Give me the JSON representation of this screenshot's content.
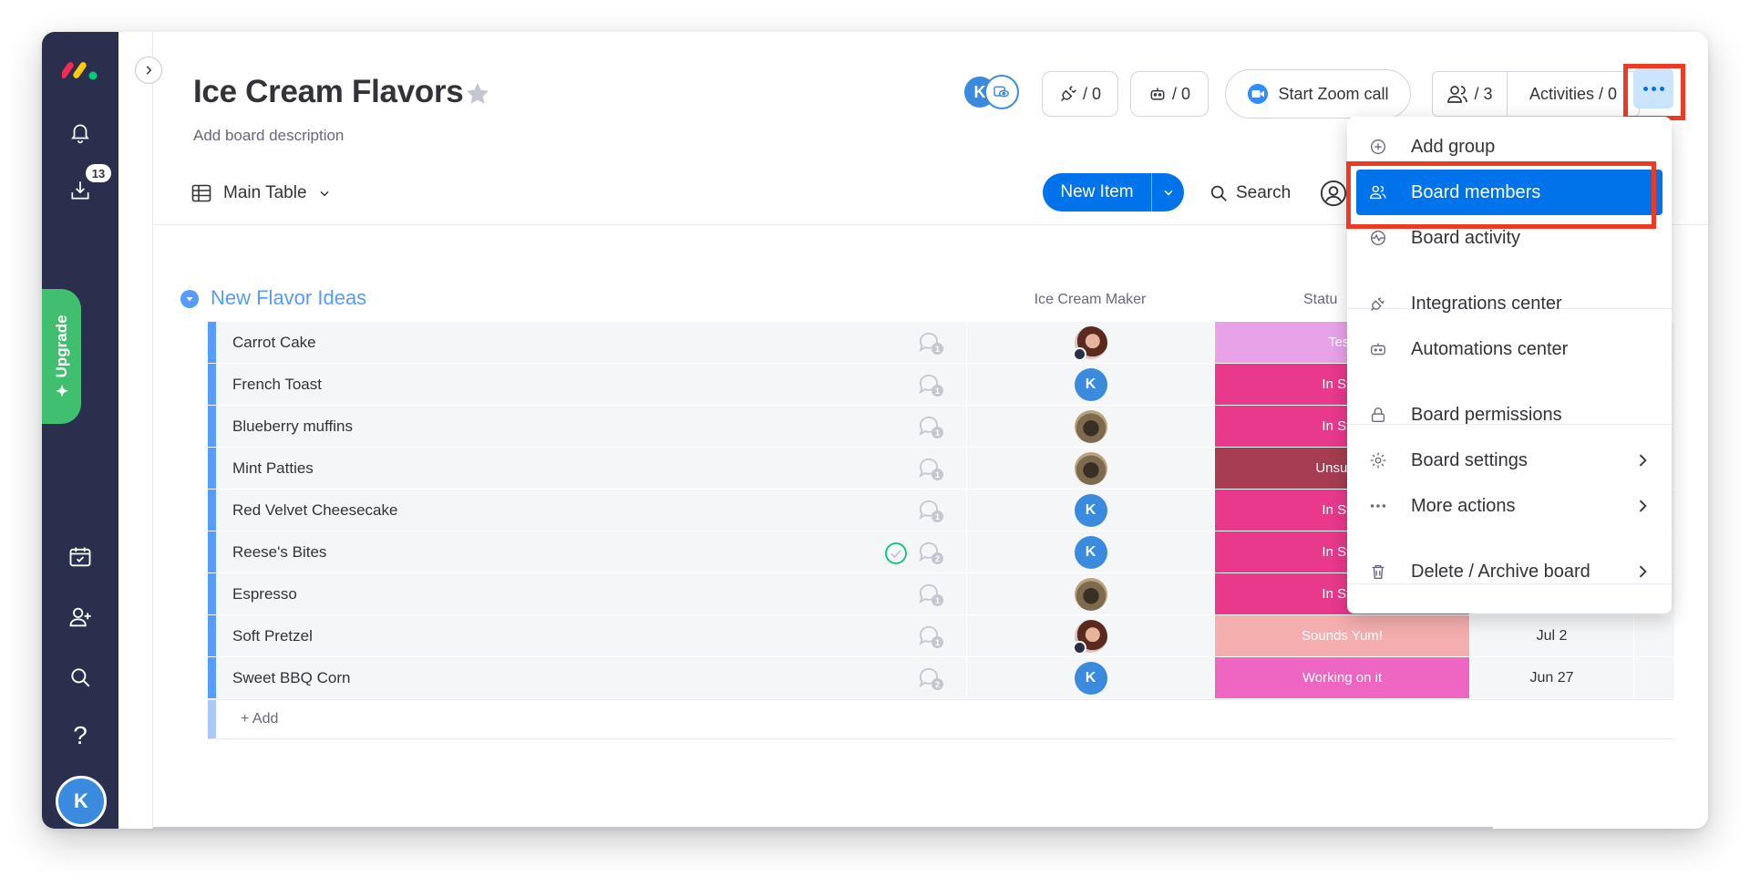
{
  "board": {
    "title": "Ice Cream Flavors",
    "description": "Add board description"
  },
  "header": {
    "avatar_initial": "K",
    "integrations_count": "/ 0",
    "automations_count": "/ 0",
    "zoom_label": "Start Zoom call",
    "members_count": "/ 3",
    "activities_label": "Activities / 0"
  },
  "rail": {
    "inbox_badge": "13",
    "upgrade_label": "Upgrade",
    "avatar_initial": "K"
  },
  "toolbar": {
    "view_label": "Main Table",
    "new_item_label": "New Item",
    "search_label": "Search"
  },
  "group": {
    "title": "New Flavor Ideas",
    "color": "#579bfc",
    "columns": [
      "Ice Cream Maker",
      "Statu"
    ],
    "add_label": "+ Add"
  },
  "rows": [
    {
      "name": "Carrot Cake",
      "comments": "1",
      "maker": "woman",
      "maker_initial": "",
      "status": "Testi",
      "status_color": "#e8a2e8",
      "date": "",
      "checked": false
    },
    {
      "name": "French Toast",
      "comments": "1",
      "maker": "k",
      "maker_initial": "K",
      "status": "In Stor",
      "status_color": "#e8398d",
      "date": "",
      "checked": false
    },
    {
      "name": "Blueberry muffins",
      "comments": "1",
      "maker": "dog",
      "maker_initial": "",
      "status": "In Stor",
      "status_color": "#e8398d",
      "date": "",
      "checked": false
    },
    {
      "name": "Mint Patties",
      "comments": "1",
      "maker": "dog",
      "maker_initial": "",
      "status": "Unsucce",
      "status_color": "#a63d52",
      "date": "",
      "checked": false
    },
    {
      "name": "Red Velvet Cheesecake",
      "comments": "1",
      "maker": "k",
      "maker_initial": "K",
      "status": "In Stor",
      "status_color": "#e8398d",
      "date": "",
      "checked": false
    },
    {
      "name": "Reese's Bites",
      "comments": "2",
      "maker": "k",
      "maker_initial": "K",
      "status": "In Stor",
      "status_color": "#e8398d",
      "date": "",
      "checked": true
    },
    {
      "name": "Espresso",
      "comments": "1",
      "maker": "dog",
      "maker_initial": "",
      "status": "In Stor",
      "status_color": "#e8398d",
      "date": "",
      "checked": false
    },
    {
      "name": "Soft Pretzel",
      "comments": "1",
      "maker": "woman",
      "maker_initial": "",
      "status": "Sounds Yum!",
      "status_color": "#f4aeae",
      "date": "Jul 2",
      "checked": false
    },
    {
      "name": "Sweet BBQ Corn",
      "comments": "2",
      "maker": "k",
      "maker_initial": "K",
      "status": "Working on it",
      "status_color": "#ef65c2",
      "date": "Jun 27",
      "checked": false
    }
  ],
  "menu": {
    "items": [
      {
        "label": "Add group",
        "icon": "plus-circle-icon",
        "chevron": false,
        "active": false
      },
      {
        "label": "Board members",
        "icon": "people-icon",
        "chevron": false,
        "active": true
      },
      {
        "label": "Board activity",
        "icon": "activity-icon",
        "chevron": false,
        "active": false
      },
      {
        "label": "Integrations center",
        "icon": "plug-icon",
        "chevron": false,
        "active": false
      },
      {
        "label": "Automations center",
        "icon": "robot-icon",
        "chevron": false,
        "active": false
      },
      {
        "label": "Board permissions",
        "icon": "lock-icon",
        "chevron": false,
        "active": false
      },
      {
        "label": "Board settings",
        "icon": "gear-icon",
        "chevron": true,
        "active": false
      },
      {
        "label": "More actions",
        "icon": "more-dots-icon",
        "chevron": true,
        "active": false
      },
      {
        "label": "Delete / Archive board",
        "icon": "trash-icon",
        "chevron": true,
        "active": false
      }
    ]
  },
  "colors": {
    "accent": "#0073ea",
    "rail": "#292f4c",
    "highlight": "#ee3a23",
    "upgrade": "#3fbf6f"
  }
}
